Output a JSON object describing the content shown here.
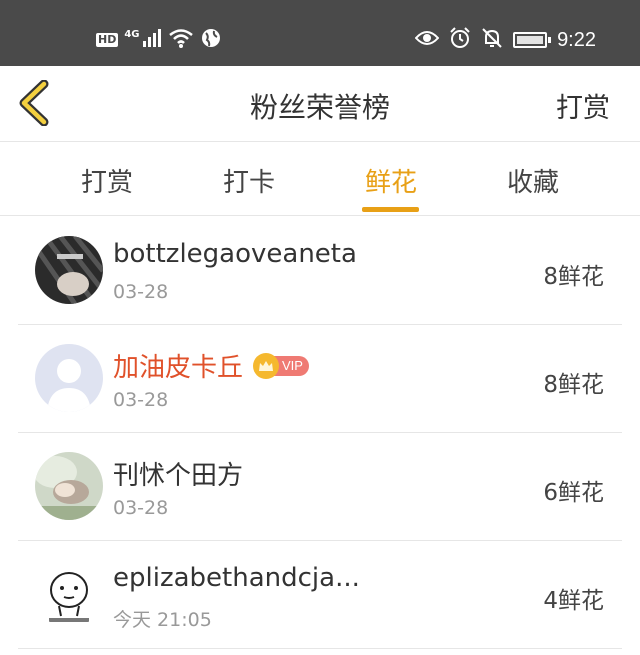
{
  "status_bar": {
    "hd": "HD",
    "network": "4G",
    "time": "9:22",
    "icons": [
      "signal-icon",
      "wifi-icon",
      "globe-icon",
      "eye-icon",
      "alarm-icon",
      "bell-off-icon",
      "battery-icon"
    ]
  },
  "nav": {
    "title": "粉丝荣誉榜",
    "action": "打赏",
    "back_icon": "chevron-left-icon",
    "accent": "#e8a016"
  },
  "tabs": [
    {
      "label": "打赏",
      "active": false
    },
    {
      "label": "打卡",
      "active": false
    },
    {
      "label": "鲜花",
      "active": true
    },
    {
      "label": "收藏",
      "active": false
    }
  ],
  "fans": [
    {
      "name": "bottzlegaoveaneta",
      "date": "03-28",
      "count": "8鲜花",
      "vip": false
    },
    {
      "name": "加油皮卡丘",
      "date": "03-28",
      "count": "8鲜花",
      "vip": true,
      "badge": "VIP"
    },
    {
      "name": "刊怵个田方",
      "date": "03-28",
      "count": "6鲜花",
      "vip": false
    },
    {
      "name": "eplizabethandcja...",
      "date": "今天 21:05",
      "count": "4鲜花",
      "vip": false
    }
  ],
  "colors": {
    "status_bar": "#4a4a4a",
    "vip_name": "#e0512a",
    "vip_badge": "#ef7a73"
  }
}
